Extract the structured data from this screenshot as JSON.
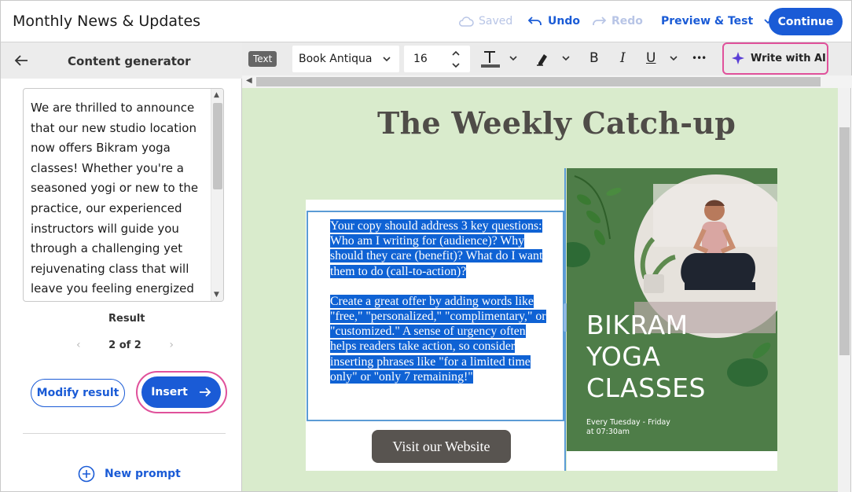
{
  "header": {
    "title": "Monthly News & Updates",
    "saved": "Saved",
    "undo": "Undo",
    "redo": "Redo",
    "preview": "Preview & Test",
    "continue": "Continue"
  },
  "sidebar": {
    "title": "Content generator",
    "generated_text": "We are thrilled to announce that our new studio location now offers Bikram yoga classes! Whether you're a seasoned yogi or new to the practice, our experienced instructors will guide you through a challenging yet rejuvenating class that will leave you feeling energized",
    "result_label": "Result",
    "pager": "2 of 2",
    "modify_button": "Modify result",
    "insert_button": "Insert",
    "new_prompt": "New prompt"
  },
  "toolbar": {
    "tag": "Text",
    "font": "Book Antiqua",
    "size": "16",
    "bold": "B",
    "italic": "I",
    "underline": "U",
    "more": "•••",
    "write_ai": "Write with AI"
  },
  "canvas": {
    "newsletter_title": "The Weekly Catch-up",
    "paragraph1": "Your copy should address 3 key questions: Who am I writing for (audience)? Why should they care (benefit)? What do I want them to do (call-to-action)?",
    "paragraph2": "Create a great offer by adding words like \"free,\" \"personalized,\" \"complimentary,\" or \"customized.\" A sense of urgency often helps readers take action, so consider inserting phrases like \"for a limited time only\" or \"only 7 remaining!\"",
    "visit_button": "Visit our Website",
    "card_line1": "BIKRAM",
    "card_line2": "YOGA",
    "card_line3": "CLASSES",
    "card_sub1": "Every Tuesday - Friday",
    "card_sub2": "at 07:30am"
  },
  "colors": {
    "accent": "#1a5bd6",
    "highlight_ring": "#e0519b",
    "canvas_bg": "#d9ebcc",
    "card_green": "#4e7d48",
    "selection": "#0f62d4"
  }
}
